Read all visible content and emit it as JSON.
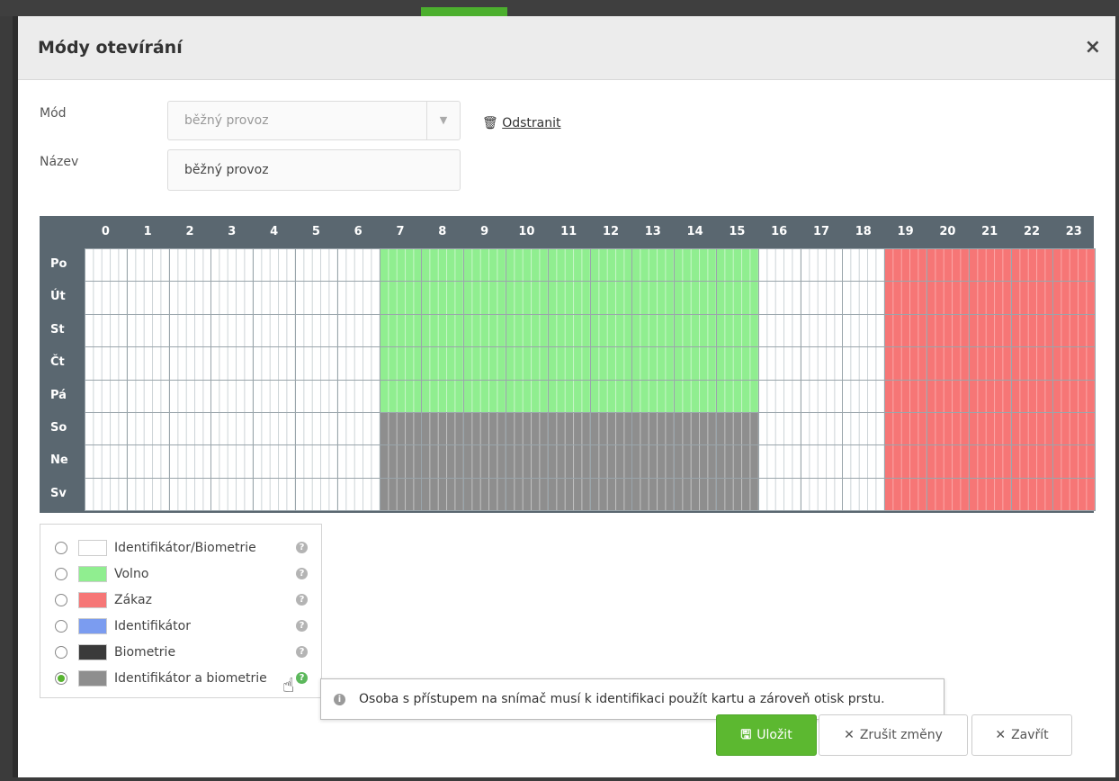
{
  "modal": {
    "title": "Módy otevírání",
    "close_icon": "×"
  },
  "form": {
    "mode_label": "Mód",
    "mode_value": "běžný provoz",
    "name_label": "Název",
    "name_value": "běžný provoz",
    "remove_label": "Odstranit",
    "remove_icon": "trash-icon"
  },
  "schedule": {
    "hours": [
      "0",
      "1",
      "2",
      "3",
      "4",
      "5",
      "6",
      "7",
      "8",
      "9",
      "10",
      "11",
      "12",
      "13",
      "14",
      "15",
      "16",
      "17",
      "18",
      "19",
      "20",
      "21",
      "22",
      "23"
    ],
    "days": [
      "Po",
      "Út",
      "St",
      "Čt",
      "Pá",
      "So",
      "Ne",
      "Sv"
    ],
    "rows": [
      [
        "w",
        "w",
        "w",
        "w",
        "w",
        "w",
        "w",
        "g",
        "g",
        "g",
        "g",
        "g",
        "g",
        "g",
        "g",
        "g",
        "w",
        "w",
        "w",
        "r",
        "r",
        "r",
        "r",
        "r"
      ],
      [
        "w",
        "w",
        "w",
        "w",
        "w",
        "w",
        "w",
        "g",
        "g",
        "g",
        "g",
        "g",
        "g",
        "g",
        "g",
        "g",
        "w",
        "w",
        "w",
        "r",
        "r",
        "r",
        "r",
        "r"
      ],
      [
        "w",
        "w",
        "w",
        "w",
        "w",
        "w",
        "w",
        "g",
        "g",
        "g",
        "g",
        "g",
        "g",
        "g",
        "g",
        "g",
        "w",
        "w",
        "w",
        "r",
        "r",
        "r",
        "r",
        "r"
      ],
      [
        "w",
        "w",
        "w",
        "w",
        "w",
        "w",
        "w",
        "g",
        "g",
        "g",
        "g",
        "g",
        "g",
        "g",
        "g",
        "g",
        "w",
        "w",
        "w",
        "r",
        "r",
        "r",
        "r",
        "r"
      ],
      [
        "w",
        "w",
        "w",
        "w",
        "w",
        "w",
        "w",
        "g",
        "g",
        "g",
        "g",
        "g",
        "g",
        "g",
        "g",
        "g",
        "w",
        "w",
        "w",
        "r",
        "r",
        "r",
        "r",
        "r"
      ],
      [
        "w",
        "w",
        "w",
        "w",
        "w",
        "w",
        "w",
        "k",
        "k",
        "k",
        "k",
        "k",
        "k",
        "k",
        "k",
        "k",
        "w",
        "w",
        "w",
        "r",
        "r",
        "r",
        "r",
        "r"
      ],
      [
        "w",
        "w",
        "w",
        "w",
        "w",
        "w",
        "w",
        "k",
        "k",
        "k",
        "k",
        "k",
        "k",
        "k",
        "k",
        "k",
        "w",
        "w",
        "w",
        "r",
        "r",
        "r",
        "r",
        "r"
      ],
      [
        "w",
        "w",
        "w",
        "w",
        "w",
        "w",
        "w",
        "k",
        "k",
        "k",
        "k",
        "k",
        "k",
        "k",
        "k",
        "k",
        "w",
        "w",
        "w",
        "r",
        "r",
        "r",
        "r",
        "r"
      ]
    ],
    "colors": {
      "w": "#ffffff",
      "g": "#90ee90",
      "r": "#f67676",
      "k": "#8e8e8e"
    }
  },
  "legend": {
    "items": [
      {
        "label": "Identifikátor/Biometrie",
        "color": "#ffffff",
        "selected": false
      },
      {
        "label": "Volno",
        "color": "#90ee90",
        "selected": false
      },
      {
        "label": "Zákaz",
        "color": "#f67676",
        "selected": false
      },
      {
        "label": "Identifikátor",
        "color": "#7b9cf0",
        "selected": false
      },
      {
        "label": "Biometrie",
        "color": "#3a3a3a",
        "selected": false
      },
      {
        "label": "Identifikátor a biometrie",
        "color": "#8e8e8e",
        "selected": true
      }
    ]
  },
  "tooltip": {
    "text": "Osoba s přístupem na snímač musí k identifikaci použít kartu a zároveň otisk prstu."
  },
  "buttons": {
    "save": "Uložit",
    "cancel": "Zrušit změny",
    "close": "Zavřít"
  }
}
